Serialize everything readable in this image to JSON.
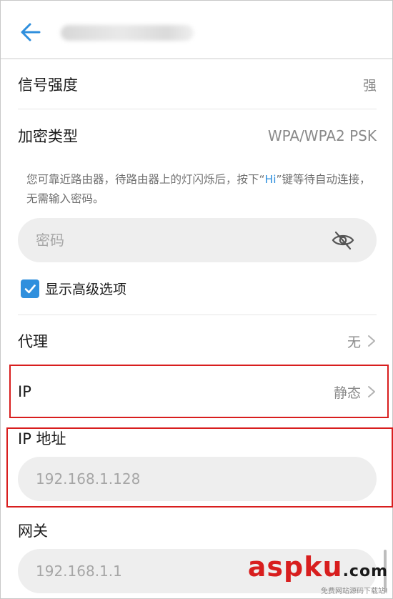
{
  "header": {
    "back_icon": "arrow-left-icon",
    "ssid_obscured": true
  },
  "signal": {
    "label": "信号强度",
    "value": "强"
  },
  "encryption": {
    "label": "加密类型",
    "value": "WPA/WPA2 PSK"
  },
  "hint": {
    "before": "您可靠近路由器，待路由器上的灯闪烁后，按下“",
    "highlight": "Hi",
    "after": "”键等待自动连接，无需输入密码。"
  },
  "password": {
    "placeholder": "密码",
    "eye_icon": "eye-hidden-icon"
  },
  "advanced": {
    "label": "显示高级选项",
    "checked": true
  },
  "proxy": {
    "label": "代理",
    "value": "无"
  },
  "ip": {
    "label": "IP",
    "value": "静态"
  },
  "ip_address": {
    "label": "IP 地址",
    "value": "192.168.1.128"
  },
  "gateway": {
    "label": "网关",
    "value": "192.168.1.1"
  },
  "watermark": {
    "brand": "aspku",
    "brand_tld": ".com",
    "caption": "免费网站源码下载站!"
  },
  "colors": {
    "accent": "#2f8fdd",
    "highlight_box": "#d81e1e"
  }
}
